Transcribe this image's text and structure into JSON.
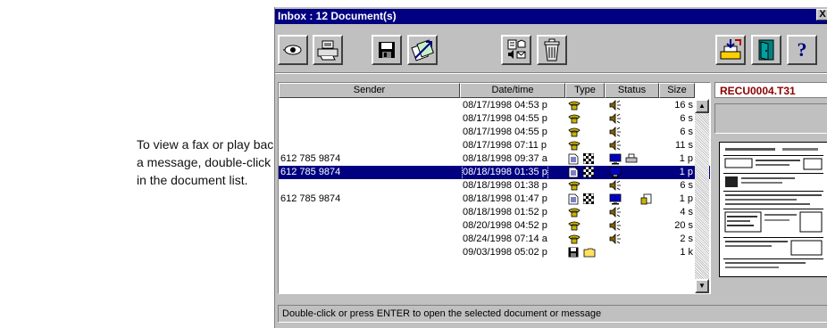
{
  "callout": {
    "line1": "To view a fax or play back",
    "line2": "a message, double-click it",
    "line3": "in the document list."
  },
  "window": {
    "title": "Inbox : 12 Document(s)",
    "close_label": "X"
  },
  "toolbar": {
    "buttons": [
      "view-icon",
      "print-icon",
      "save-icon",
      "forward-icon",
      "voice-fax-icon",
      "trash-icon",
      "receive-icon",
      "exit-icon",
      "help-icon"
    ],
    "help_label": "?"
  },
  "columns": {
    "sender": "Sender",
    "datetime": "Date/time",
    "type": "Type",
    "status": "Status",
    "size": "Size"
  },
  "rows": [
    {
      "sender": "",
      "datetime": "08/17/1998 04:53 p",
      "type": [
        "phone"
      ],
      "status": [
        "speaker"
      ],
      "size": "16 s"
    },
    {
      "sender": "",
      "datetime": "08/17/1998 04:55 p",
      "type": [
        "phone"
      ],
      "status": [
        "speaker"
      ],
      "size": "6 s"
    },
    {
      "sender": "",
      "datetime": "08/17/1998 04:55 p",
      "type": [
        "phone"
      ],
      "status": [
        "speaker"
      ],
      "size": "6 s"
    },
    {
      "sender": "",
      "datetime": "08/17/1998 07:11 p",
      "type": [
        "phone"
      ],
      "status": [
        "speaker"
      ],
      "size": "11 s"
    },
    {
      "sender": "612 785 9874",
      "datetime": "08/18/1998 09:37 a",
      "type": [
        "document",
        "checker"
      ],
      "status": [
        "monitor",
        "printer"
      ],
      "size": "1 p"
    },
    {
      "sender": "612 785 9874",
      "datetime": "08/18/1998 01:35 p",
      "type": [
        "document",
        "checker"
      ],
      "status": [
        "monitor"
      ],
      "size": "1 p",
      "selected": true
    },
    {
      "sender": "",
      "datetime": "08/18/1998 01:38 p",
      "type": [
        "phone"
      ],
      "status": [
        "speaker"
      ],
      "size": "6 s"
    },
    {
      "sender": "612 785 9874",
      "datetime": "08/18/1998 01:47 p",
      "type": [
        "document",
        "checker"
      ],
      "status": [
        "monitor",
        "forward"
      ],
      "size": "1 p"
    },
    {
      "sender": "",
      "datetime": "08/18/1998 01:52 p",
      "type": [
        "phone"
      ],
      "status": [
        "speaker"
      ],
      "size": "4 s"
    },
    {
      "sender": "",
      "datetime": "08/20/1998 04:52 p",
      "type": [
        "phone"
      ],
      "status": [
        "speaker"
      ],
      "size": "20 s"
    },
    {
      "sender": "",
      "datetime": "08/24/1998 07:14 a",
      "type": [
        "phone"
      ],
      "status": [
        "speaker"
      ],
      "size": "2 s"
    },
    {
      "sender": "",
      "datetime": "09/03/1998 05:02 p",
      "type": [
        "disk",
        "folder"
      ],
      "status": [],
      "size": "1 k"
    }
  ],
  "preview": {
    "filename": "RECU0004.T31"
  },
  "statusbar": {
    "text": "Double-click or press ENTER to open the selected document or message"
  },
  "colors": {
    "selection": "#000080",
    "titlebar": "#000080",
    "filename": "#8b0000",
    "face": "#c0c0c0"
  }
}
